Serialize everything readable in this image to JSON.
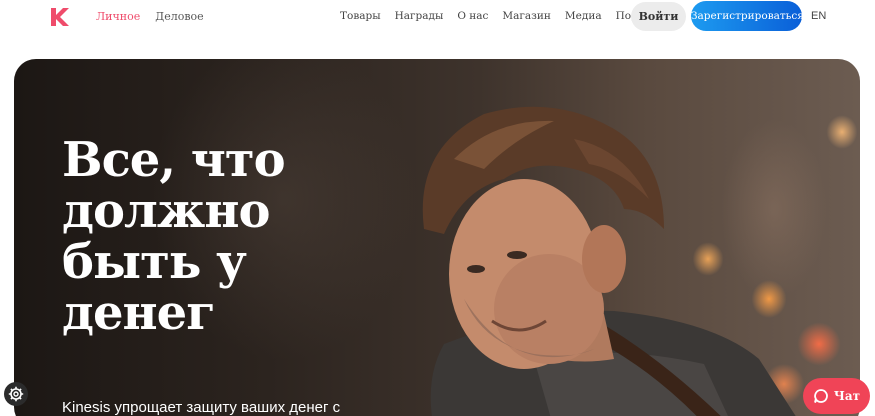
{
  "nav": {
    "logo_icon": "kinesis-k-logo",
    "segments": {
      "personal": "Личное",
      "business": "Деловое"
    },
    "links": [
      "Товары",
      "Награды",
      "О нас",
      "Магазин",
      "Медиа",
      "Поддержка"
    ],
    "login": "Войти",
    "register": "Зарегистрироваться",
    "language": "EN"
  },
  "hero": {
    "headline": "Все, что должно быть у денег",
    "subline": "Kinesis упрощает защиту ваших денег с"
  },
  "fabs": {
    "settings_icon": "gear-icon",
    "chat_icon": "chat-bubble-icon",
    "chat_label": "Чат"
  },
  "colors": {
    "accent_pink": "#ef4c6b",
    "register_blue": "#1d9bf0",
    "chat_red": "#f04457"
  }
}
